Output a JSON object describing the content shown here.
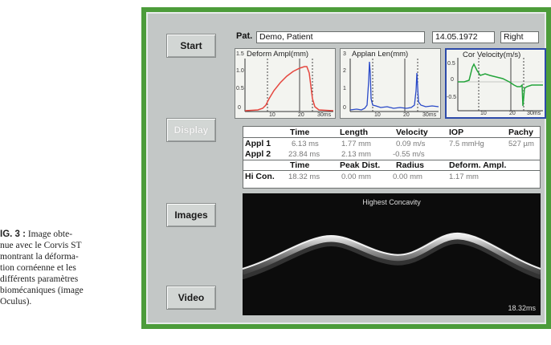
{
  "caption": {
    "lead": "IG. 3 :",
    "lines": [
      "Image obte-",
      "nue avec le Corvis ST",
      "montrant la déforma-",
      "tion cornéenne et les",
      "différents paramètres",
      "biomécaniques (image",
      "Oculus)."
    ]
  },
  "buttons": {
    "start": "Start",
    "display": "Display",
    "images": "Images",
    "video": "Video"
  },
  "patient": {
    "label": "Pat.",
    "name": "Demo, Patient",
    "date": "14.05.1972",
    "eye": "Right"
  },
  "graphs": {
    "deform": {
      "title": "Deform Ampl(mm)",
      "yticks": [
        "1.5",
        "1.0",
        "0.5",
        "0"
      ],
      "xticks": [
        "10",
        "20",
        "30ms"
      ],
      "color": "#e5473f"
    },
    "applan": {
      "title": "Applan Len(mm)",
      "yticks": [
        "3",
        "2",
        "1",
        "0"
      ],
      "xticks": [
        "10",
        "20",
        "30ms"
      ],
      "color": "#2949c8"
    },
    "velocity": {
      "title": "Cor Velocity(m/s)",
      "yticks": [
        "0.5",
        "0",
        "-0.5"
      ],
      "xticks": [
        "10",
        "20",
        "30ms"
      ],
      "color": "#23a43a"
    }
  },
  "table": {
    "head1": [
      "Time",
      "Length",
      "Velocity",
      "IOP",
      "Pachy"
    ],
    "row1": {
      "label": "Appl 1",
      "values": [
        "6.13 ms",
        "1.77 mm",
        "0.09 m/s",
        "7.5 mmHg",
        "527 µm"
      ]
    },
    "row2": {
      "label": "Appl 2",
      "values": [
        "23.84 ms",
        "2.13 mm",
        "-0.55 m/s"
      ]
    },
    "head2": [
      "Time",
      "Peak Dist.",
      "Radius",
      "Deform. Ampl."
    ],
    "row3": {
      "label": "Hi Con.",
      "values": [
        "18.32 ms",
        "0.00 mm",
        "0.00 mm",
        "1.17 mm"
      ]
    }
  },
  "image": {
    "title": "Highest Concavity",
    "time": "18.32ms"
  }
}
